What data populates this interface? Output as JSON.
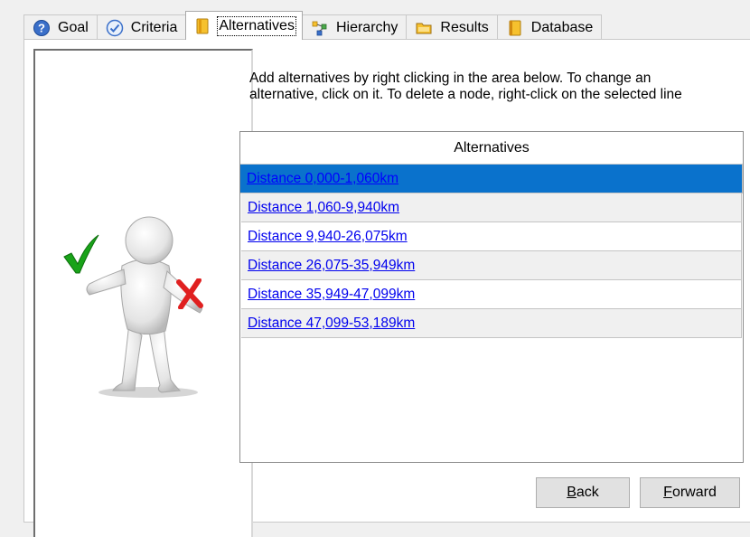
{
  "tabs": [
    {
      "label": "Goal",
      "icon": "question-icon"
    },
    {
      "label": "Criteria",
      "icon": "check-circle-icon"
    },
    {
      "label": "Alternatives",
      "icon": "document-icon",
      "active": true
    },
    {
      "label": "Hierarchy",
      "icon": "hierarchy-icon"
    },
    {
      "label": "Results",
      "icon": "folder-icon"
    },
    {
      "label": "Database",
      "icon": "book-icon"
    }
  ],
  "instructions": "Add alternatives by right clicking in the area below. To change an alternative, click on it. To delete a node, right-click on the selected line",
  "grid": {
    "header": "Alternatives",
    "rows": [
      "Distance 0,000-1,060km",
      "Distance 1,060-9,940km",
      "Distance 9,940-26,075km",
      "Distance 26,075-35,949km",
      "Distance 35,949-47,099km",
      "Distance 47,099-53,189km"
    ],
    "selected_index": 0
  },
  "buttons": {
    "back": {
      "mnemonic": "B",
      "rest": "ack"
    },
    "forward": {
      "mnemonic": "F",
      "rest": "orward"
    }
  },
  "colors": {
    "selection": "#0a72cc",
    "link": "#0000ee",
    "check_green": "#19a319",
    "cross_red": "#e02020"
  }
}
